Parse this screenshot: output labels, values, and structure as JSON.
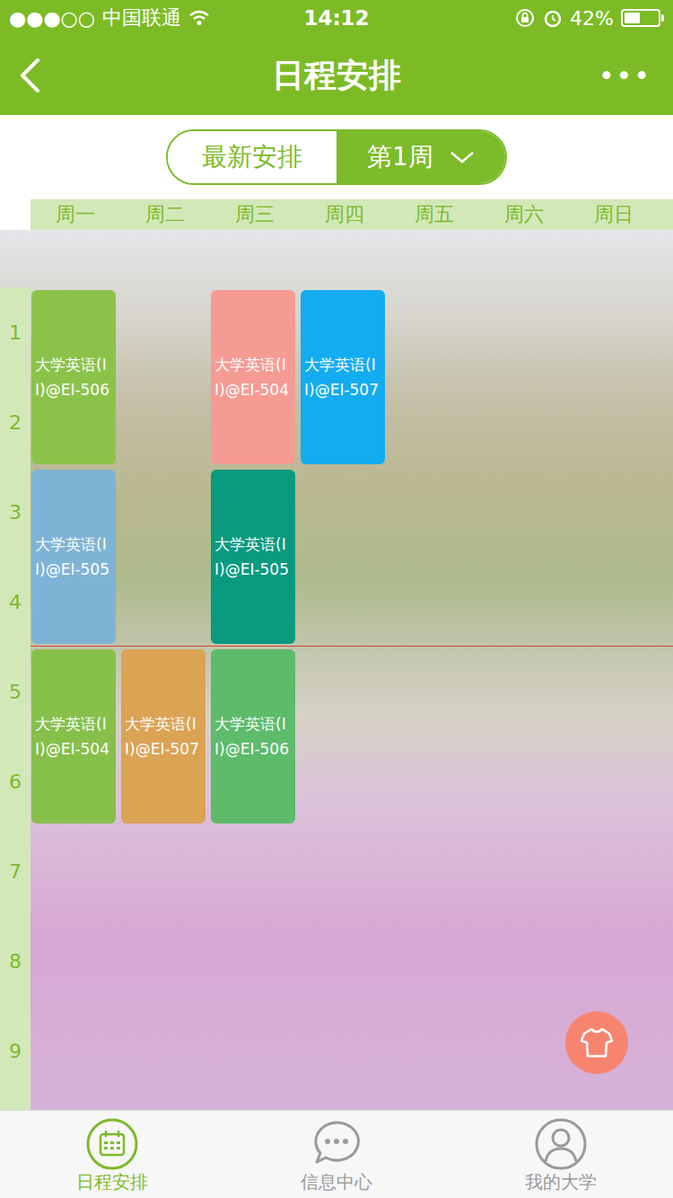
{
  "status_bar": {
    "signal": "●●●○○",
    "carrier": "中国联通",
    "time": "14:12",
    "battery": "42%",
    "battery_level": 0.42
  },
  "nav": {
    "title": "日程安排",
    "more": "•••"
  },
  "segments": [
    {
      "label": "最新安排",
      "selected": false,
      "dropdown": false
    },
    {
      "label": "第1周",
      "selected": true,
      "dropdown": true
    }
  ],
  "weekdays": [
    "周一",
    "周二",
    "周三",
    "周四",
    "周五",
    "周六",
    "周日"
  ],
  "periods": [
    "1",
    "2",
    "3",
    "4",
    "5",
    "6",
    "7",
    "8",
    "9"
  ],
  "courses": [
    {
      "title": "大学英语(II)@EI-506",
      "day": 0,
      "start": 1,
      "span": 2,
      "color": "#8bc34a"
    },
    {
      "title": "大学英语(II)@EI-504",
      "day": 2,
      "start": 1,
      "span": 2,
      "color": "#f59b93"
    },
    {
      "title": "大学英语(II)@EI-507",
      "day": 3,
      "start": 1,
      "span": 2,
      "color": "#13acf0"
    },
    {
      "title": "大学英语(II)@EI-505",
      "day": 0,
      "start": 3,
      "span": 2,
      "color": "#7fb3d5"
    },
    {
      "title": "大学英语(II)@EI-505",
      "day": 2,
      "start": 3,
      "span": 2,
      "color": "#0a9a7f"
    },
    {
      "title": "大学英语(II)@EI-504",
      "day": 0,
      "start": 5,
      "span": 2,
      "color": "#86c04a"
    },
    {
      "title": "大学英语(II)@EI-507",
      "day": 1,
      "start": 5,
      "span": 2,
      "color": "#dba354"
    },
    {
      "title": "大学英语(II)@EI-506",
      "day": 2,
      "start": 5,
      "span": 2,
      "color": "#5dbb6b"
    }
  ],
  "now_line": {
    "shown": true,
    "after_period": 4
  },
  "tabs": [
    {
      "label": "日程安排",
      "selected": true,
      "kind": "calendar"
    },
    {
      "label": "信息中心",
      "selected": false,
      "kind": "chat"
    },
    {
      "label": "我的大学",
      "selected": false,
      "kind": "person"
    }
  ]
}
